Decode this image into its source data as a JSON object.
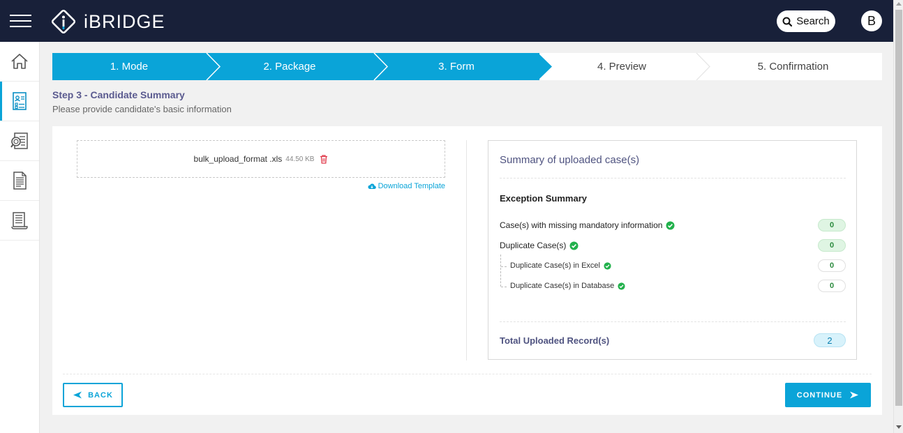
{
  "header": {
    "brand": "iBRIDGE",
    "search_label": "Search",
    "avatar_initial": "B"
  },
  "sidebar": {
    "items": [
      {
        "icon": "home-icon",
        "active": false
      },
      {
        "icon": "form-document-icon",
        "active": true
      },
      {
        "icon": "search-document-icon",
        "active": false
      },
      {
        "icon": "report-document-icon",
        "active": false
      },
      {
        "icon": "ledger-document-icon",
        "active": false
      }
    ]
  },
  "stepper": {
    "steps": [
      {
        "label": "1. Mode",
        "status": "done"
      },
      {
        "label": "2. Package",
        "status": "done"
      },
      {
        "label": "3. Form",
        "status": "current"
      },
      {
        "label": "4. Preview",
        "status": "todo"
      },
      {
        "label": "5. Confirmation",
        "status": "todo"
      }
    ]
  },
  "page": {
    "title": "Step 3 - Candidate Summary",
    "subtitle": "Please provide candidate's basic information"
  },
  "upload": {
    "file_name": "bulk_upload_format .xls",
    "file_size": "44.50 KB",
    "download_label": "Download Template"
  },
  "summary": {
    "title": "Summary of uploaded case(s)",
    "exception_title": "Exception Summary",
    "rows": [
      {
        "label": "Case(s) with missing mandatory information",
        "value": "0"
      },
      {
        "label": "Duplicate Case(s)",
        "value": "0"
      },
      {
        "label": "Duplicate Case(s) in Excel",
        "value": "0"
      },
      {
        "label": "Duplicate Case(s) in Database",
        "value": "0"
      }
    ],
    "total_label": "Total Uploaded Record(s)",
    "total_value": "2"
  },
  "actions": {
    "back_label": "BACK",
    "continue_label": "CONTINUE"
  },
  "colors": {
    "accent": "#0aa4d8",
    "header_bg": "#182039",
    "success": "#22b14c"
  }
}
